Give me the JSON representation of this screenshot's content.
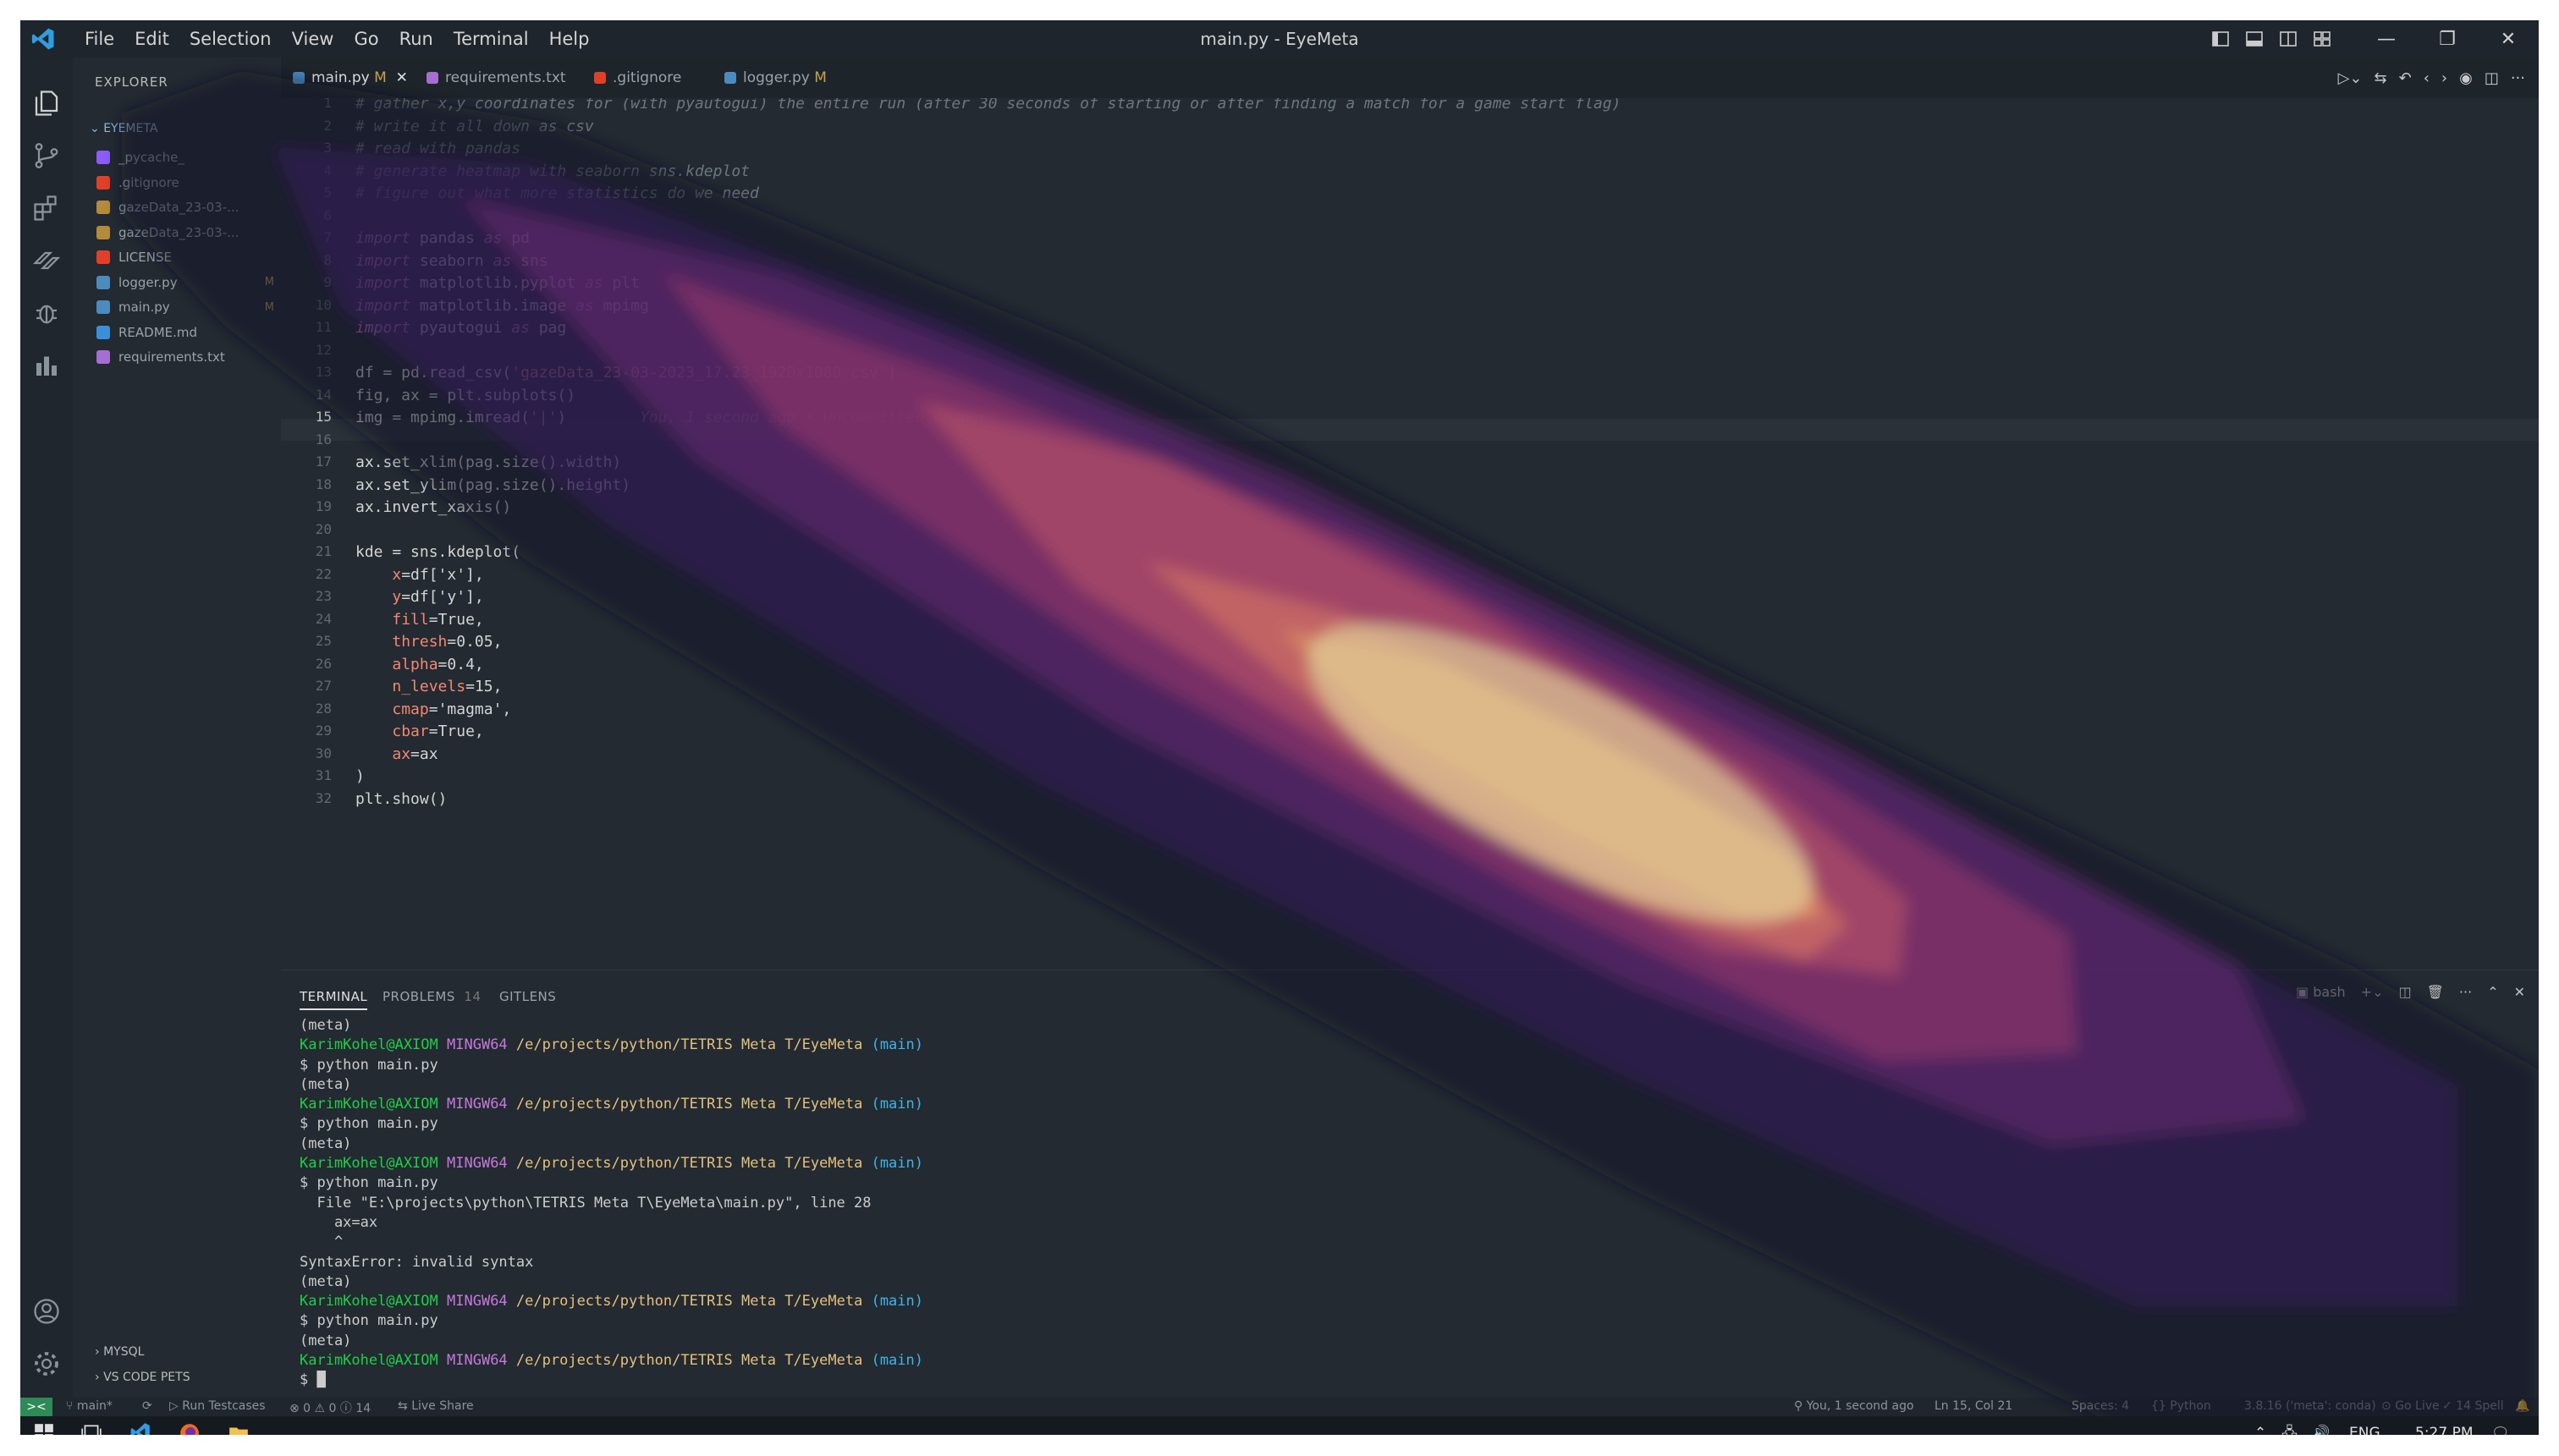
{
  "window": {
    "title": "main.py - EyeMeta"
  },
  "menu": [
    "File",
    "Edit",
    "Selection",
    "View",
    "Go",
    "Run",
    "Terminal",
    "Help"
  ],
  "sidebar": {
    "header": "EXPLORER",
    "folder": "EYEMETA",
    "items": [
      {
        "label": "_pycache_",
        "badge": "",
        "color": "#8b5cf6"
      },
      {
        "label": ".gitignore",
        "badge": "",
        "color": "#e0402a"
      },
      {
        "label": "gazeData_23-03-...",
        "badge": "",
        "color": "#b58a3a"
      },
      {
        "label": "gazeData_23-03-...",
        "badge": "",
        "color": "#b58a3a"
      },
      {
        "label": "LICENSE",
        "badge": "",
        "color": "#e0402a"
      },
      {
        "label": "logger.py",
        "badge": "M",
        "color": "#4b8bbe"
      },
      {
        "label": "main.py",
        "badge": "M",
        "color": "#4b8bbe"
      },
      {
        "label": "README.md",
        "badge": "",
        "color": "#3a8fd8"
      },
      {
        "label": "requirements.txt",
        "badge": "",
        "color": "#a66ed0"
      }
    ],
    "sections": [
      "MYSQL",
      "VS CODE PETS"
    ]
  },
  "tabs": [
    {
      "label": "main.py",
      "badge": "M",
      "color": "#4b8bbe"
    },
    {
      "label": "requirements.txt",
      "badge": "",
      "color": "#a66ed0"
    },
    {
      "label": ".gitignore",
      "badge": "",
      "color": "#e0402a"
    },
    {
      "label": "logger.py",
      "badge": "M",
      "color": "#4b8bbe"
    }
  ],
  "editor": {
    "line_numbers": [
      "1",
      "2",
      "3",
      "4",
      "5",
      "6",
      "7",
      "8",
      "9",
      "10",
      "11",
      "12",
      "13",
      "14",
      "15",
      "16",
      "17",
      "18",
      "19",
      "20",
      "21",
      "22",
      "23",
      "24",
      "25",
      "26",
      "27",
      "28",
      "29",
      "30",
      "31",
      "32"
    ],
    "comments": [
      "# gather x,y coordinates for (with pyautogui) the entire run (after 30 seconds of starting or after finding a match for a game start flag)",
      "# write it all down as csv",
      "# read with pandas",
      "# generate heatmap with seaborn sns.kdeplot",
      "# figure out what more statistics do we need"
    ],
    "imports": [
      {
        "mod": "pandas",
        "alias": "pd"
      },
      {
        "mod": "seaborn",
        "alias": "sns"
      },
      {
        "mod": "matplotlib.pyplot",
        "alias": "plt"
      },
      {
        "mod": "matplotlib.image",
        "alias": "mpimg"
      },
      {
        "mod": "pyautogui",
        "alias": "pag"
      }
    ],
    "kw_import": "import",
    "kw_as": "as",
    "df_head": "df = pd.read_csv(",
    "df_arg": "'gazeData_23-03-2023_17.23_1920x1080.csv'",
    "df_tail": ")",
    "fig_line": "fig, ax = plt.subplots()",
    "img_head": "img = mpimg.imread(",
    "img_arg": "'|'",
    "img_tail": ")",
    "blame": "You, 1 second ago • Uncommitted changes",
    "xlim": "ax.set_xlim(pag.size().width)",
    "ylim": "ax.set_ylim(pag.size().height)",
    "invert": "ax.invert_xaxis()",
    "kde_head": "kde = sns.kdeplot(",
    "kw_args": [
      {
        "k": "x",
        "v": "df['x'],"
      },
      {
        "k": "y",
        "v": "df['y'],"
      },
      {
        "k": "fill",
        "v": "True,"
      },
      {
        "k": "thresh",
        "v": "0.05,"
      },
      {
        "k": "alpha",
        "v": "0.4,"
      },
      {
        "k": "n_levels",
        "v": "15,"
      },
      {
        "k": "cmap",
        "v": "'magma',"
      },
      {
        "k": "cbar",
        "v": "True,"
      },
      {
        "k": "ax",
        "v": "ax"
      }
    ],
    "close_paren": ")",
    "show": "plt.show()"
  },
  "panel": {
    "tabs": [
      "TERMINAL",
      "PROBLEMS",
      "GITLENS"
    ],
    "problems_count": "14",
    "shell": "bash",
    "prompt": {
      "user": "KarimKohel@AXIOM",
      "host": "MINGW64",
      "path": "/e/projects/python/TETRIS Meta T/EyeMeta",
      "branch": "(main)"
    },
    "lines": [
      {
        "t": "plain",
        "text": "(meta)"
      },
      {
        "t": "prompt"
      },
      {
        "t": "plain",
        "text": "$ python main.py"
      },
      {
        "t": "plain",
        "text": "(meta)"
      },
      {
        "t": "prompt"
      },
      {
        "t": "plain",
        "text": "$ python main.py"
      },
      {
        "t": "plain",
        "text": "(meta)"
      },
      {
        "t": "prompt"
      },
      {
        "t": "plain",
        "text": "$ python main.py"
      },
      {
        "t": "plain",
        "text": "  File \"E:\\projects\\python\\TETRIS Meta T\\EyeMeta\\main.py\", line 28"
      },
      {
        "t": "plain",
        "text": "    ax=ax"
      },
      {
        "t": "plain",
        "text": "    ^"
      },
      {
        "t": "plain",
        "text": "SyntaxError: invalid syntax"
      },
      {
        "t": "plain",
        "text": "(meta)"
      },
      {
        "t": "prompt"
      },
      {
        "t": "plain",
        "text": "$ python main.py"
      },
      {
        "t": "plain",
        "text": "(meta)"
      },
      {
        "t": "prompt"
      },
      {
        "t": "plain",
        "text": "$ █"
      }
    ]
  },
  "status": {
    "remote": "><",
    "branch": "main*",
    "sync": "⟳",
    "tests": "Run Testcases",
    "problems": "⊗ 0 ⚠ 0 ⓘ 14",
    "live_share": "Live Share",
    "blame": "You, 1 second ago",
    "position": "Ln 15, Col 21",
    "spaces": "Spaces: 4",
    "language": "Python",
    "interpreter": "3.8.16 ('meta': conda)",
    "go_live": "Go Live",
    "spell": "14 Spell"
  },
  "taskbar": {
    "lang": "ENG",
    "time": "5:27 PM"
  },
  "colors": {
    "accent": "#2e8a57",
    "bg": "#232a31"
  }
}
